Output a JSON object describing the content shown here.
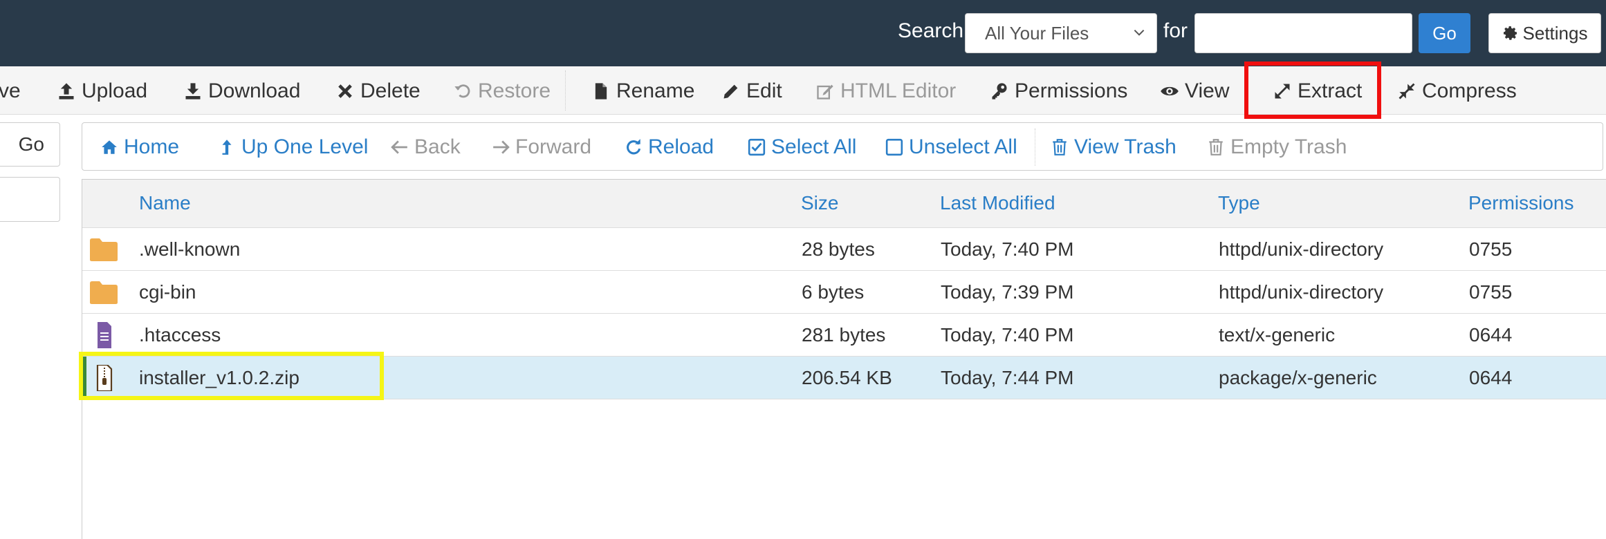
{
  "header": {
    "search_label": "Search",
    "search_scope": "All Your Files",
    "for_label": "for",
    "search_query": "",
    "go_label": "Go",
    "settings_label": "Settings"
  },
  "toolbar": {
    "items": [
      {
        "label": "ve",
        "icon": "truncated",
        "disabled": false
      },
      {
        "label": "Upload",
        "icon": "upload-icon",
        "disabled": false
      },
      {
        "label": "Download",
        "icon": "download-icon",
        "disabled": false
      },
      {
        "label": "Delete",
        "icon": "close-icon",
        "disabled": false
      },
      {
        "label": "Restore",
        "icon": "undo-icon",
        "disabled": true
      },
      {
        "label": "Rename",
        "icon": "file-icon",
        "disabled": false
      },
      {
        "label": "Edit",
        "icon": "pencil-icon",
        "disabled": false
      },
      {
        "label": "HTML Editor",
        "icon": "edit-square-icon",
        "disabled": true
      },
      {
        "label": "Permissions",
        "icon": "key-icon",
        "disabled": false
      },
      {
        "label": "View",
        "icon": "eye-icon",
        "disabled": false
      },
      {
        "label": "Extract",
        "icon": "expand-icon",
        "disabled": false
      },
      {
        "label": "Compress",
        "icon": "compress-icon",
        "disabled": false
      }
    ]
  },
  "left_panel": {
    "go_label": "Go"
  },
  "nav": {
    "items": [
      {
        "label": "Home",
        "icon": "home-icon",
        "disabled": false
      },
      {
        "label": "Up One Level",
        "icon": "level-up-icon",
        "disabled": false
      },
      {
        "label": "Back",
        "icon": "arrow-left-icon",
        "disabled": true
      },
      {
        "label": "Forward",
        "icon": "arrow-right-icon",
        "disabled": true
      },
      {
        "label": "Reload",
        "icon": "refresh-icon",
        "disabled": false
      },
      {
        "label": "Select All",
        "icon": "checkbox-checked-icon",
        "disabled": false
      },
      {
        "label": "Unselect All",
        "icon": "checkbox-empty-icon",
        "disabled": false
      },
      {
        "label": "View Trash",
        "icon": "trash-icon",
        "disabled": false
      },
      {
        "label": "Empty Trash",
        "icon": "trash-icon",
        "disabled": true
      }
    ]
  },
  "table": {
    "columns": [
      "Name",
      "Size",
      "Last Modified",
      "Type",
      "Permissions"
    ],
    "rows": [
      {
        "name": ".well-known",
        "size": "28 bytes",
        "modified": "Today, 7:40 PM",
        "type": "httpd/unix-directory",
        "perms": "0755",
        "icon": "folder-icon",
        "selected": false
      },
      {
        "name": "cgi-bin",
        "size": "6 bytes",
        "modified": "Today, 7:39 PM",
        "type": "httpd/unix-directory",
        "perms": "0755",
        "icon": "folder-icon",
        "selected": false
      },
      {
        "name": ".htaccess",
        "size": "281 bytes",
        "modified": "Today, 7:40 PM",
        "type": "text/x-generic",
        "perms": "0644",
        "icon": "text-file-icon",
        "selected": false
      },
      {
        "name": "installer_v1.0.2.zip",
        "size": "206.54 KB",
        "modified": "Today, 7:44 PM",
        "type": "package/x-generic",
        "perms": "0644",
        "icon": "zip-file-icon",
        "selected": true
      }
    ]
  },
  "colors": {
    "header_bg": "#293a4a",
    "link_blue": "#2a7ec7",
    "go_button": "#2f80d1",
    "extract_highlight": "#f00f0f",
    "selection_highlight": "#f5f516",
    "selected_row": "#d9edf7",
    "folder": "#f0ad4e",
    "text_file": "#7b5aa6"
  }
}
